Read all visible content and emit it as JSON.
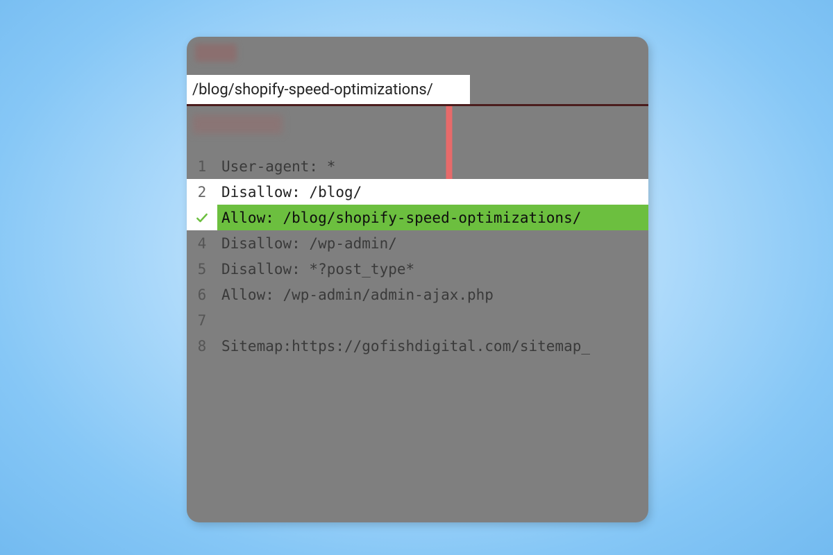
{
  "urlBar": {
    "value": "/blog/shopify-speed-optimizations/"
  },
  "code": {
    "lines": [
      {
        "num": "1",
        "text": "User-agent: *",
        "state": "dim"
      },
      {
        "num": "2",
        "text": "Disallow: /blog/",
        "state": "white"
      },
      {
        "num": "✓",
        "text": "Allow: /blog/shopify-speed-optimizations/",
        "state": "green"
      },
      {
        "num": "4",
        "text": "Disallow: /wp-admin/",
        "state": "dim"
      },
      {
        "num": "5",
        "text": "Disallow: *?post_type*",
        "state": "dim"
      },
      {
        "num": "6",
        "text": "Allow: /wp-admin/admin-ajax.php",
        "state": "dim"
      },
      {
        "num": "7",
        "text": "",
        "state": "dim"
      },
      {
        "num": "8",
        "text": "Sitemap:https://gofishdigital.com/sitemap_",
        "state": "dim"
      }
    ]
  },
  "colors": {
    "greenHighlight": "#6cbf3f",
    "arrow": "#e76a6a"
  }
}
